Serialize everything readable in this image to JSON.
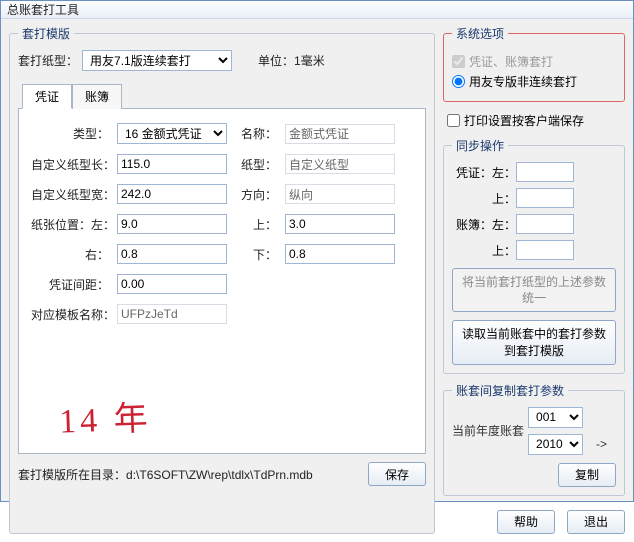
{
  "window": {
    "title": "总账套打工具"
  },
  "template": {
    "group_label": "套打模版",
    "paper_label": "套打纸型：",
    "paper_value": "用友7.1版连续套打",
    "unit_label": "单位：1毫米",
    "tabs": {
      "voucher": "凭证",
      "ledger": "账簿"
    },
    "form": {
      "type_label": "类型：",
      "type_value": "16 金额式凭证",
      "name_label": "名称：",
      "name_value": "金额式凭证",
      "custom_len_label": "自定义纸型长：",
      "custom_len_value": "115.0",
      "ptype_label": "纸型：",
      "ptype_value": "自定义纸型",
      "custom_wid_label": "自定义纸型宽：",
      "custom_wid_value": "242.0",
      "dir_label": "方向：",
      "dir_value": "纵向",
      "pos_left_label": "纸张位置：左：",
      "pos_left_value": "9.0",
      "pos_top_label": "上：",
      "pos_top_value": "3.0",
      "right_label": "右：",
      "right_value": "0.8",
      "bottom_label": "下：",
      "bottom_value": "0.8",
      "gap_label": "凭证间距：",
      "gap_value": "0.00",
      "tpl_label": "对应模板名称：",
      "tpl_value": "UFPzJeTd"
    },
    "handnote": "14 年",
    "path_label": "套打模版所在目录：",
    "path_value": "d:\\T6SOFT\\ZW\\rep\\tdlx\\TdPrn.mdb",
    "save_label": "保存"
  },
  "sysopt": {
    "group_label": "系统选项",
    "chk_voucher_ledger": "凭证、账簿套打",
    "radio_noncont": "用友专版非连续套打",
    "chk_client_save": "打印设置按客户端保存"
  },
  "sync": {
    "group_label": "同步操作",
    "voucher_label": "凭证：",
    "ledger_label": "账簿：",
    "left_label": "左：",
    "top_label": "上：",
    "unify_btn": "将当前套打纸型的上述参数统一",
    "read_btn": "读取当前账套中的套打参数到套打模版"
  },
  "copy": {
    "group_label": "账套间复制套打参数",
    "from_value": "001",
    "to_value": "2010",
    "arrow": "->",
    "target_label": "当前年度账套",
    "copy_label": "复制"
  },
  "footer": {
    "help": "帮助",
    "exit": "退出"
  }
}
